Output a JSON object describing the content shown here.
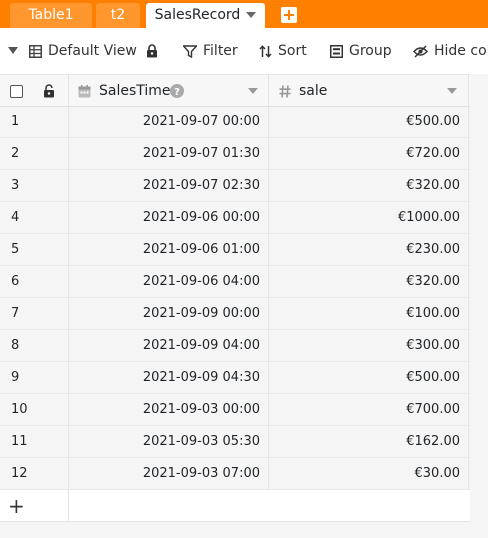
{
  "tabs": [
    {
      "label": "Table1",
      "active": false
    },
    {
      "label": "t2",
      "active": false
    },
    {
      "label": "SalesRecord",
      "active": true
    }
  ],
  "toolbar": {
    "view_label": "Default View",
    "filter_label": "Filter",
    "sort_label": "Sort",
    "group_label": "Group",
    "hide_label": "Hide colu"
  },
  "columns": [
    {
      "name": "SalesTime",
      "type_icon": "calendar-icon",
      "has_help": true
    },
    {
      "name": "sale",
      "type_icon": "hash-icon",
      "has_help": false
    }
  ],
  "rows": [
    {
      "index": "1",
      "sales_time": "2021-09-07 00:00",
      "sale": "€500.00"
    },
    {
      "index": "2",
      "sales_time": "2021-09-07 01:30",
      "sale": "€720.00"
    },
    {
      "index": "3",
      "sales_time": "2021-09-07 02:30",
      "sale": "€320.00"
    },
    {
      "index": "4",
      "sales_time": "2021-09-06 00:00",
      "sale": "€1000.00"
    },
    {
      "index": "5",
      "sales_time": "2021-09-06 01:00",
      "sale": "€230.00"
    },
    {
      "index": "6",
      "sales_time": "2021-09-06 04:00",
      "sale": "€320.00"
    },
    {
      "index": "7",
      "sales_time": "2021-09-09 00:00",
      "sale": "€100.00"
    },
    {
      "index": "8",
      "sales_time": "2021-09-09 04:00",
      "sale": "€300.00"
    },
    {
      "index": "9",
      "sales_time": "2021-09-09 04:30",
      "sale": "€500.00"
    },
    {
      "index": "10",
      "sales_time": "2021-09-03 00:00",
      "sale": "€700.00"
    },
    {
      "index": "11",
      "sales_time": "2021-09-03 05:30",
      "sale": "€162.00"
    },
    {
      "index": "12",
      "sales_time": "2021-09-03 07:00",
      "sale": "€30.00"
    }
  ],
  "add_row_symbol": "+",
  "colors": {
    "accent": "#ff8000",
    "tab_text": "#ffffff",
    "grid_border": "#e9e9e9",
    "header_bg": "#f7f7f7",
    "page_bg": "#f5f5f5"
  }
}
